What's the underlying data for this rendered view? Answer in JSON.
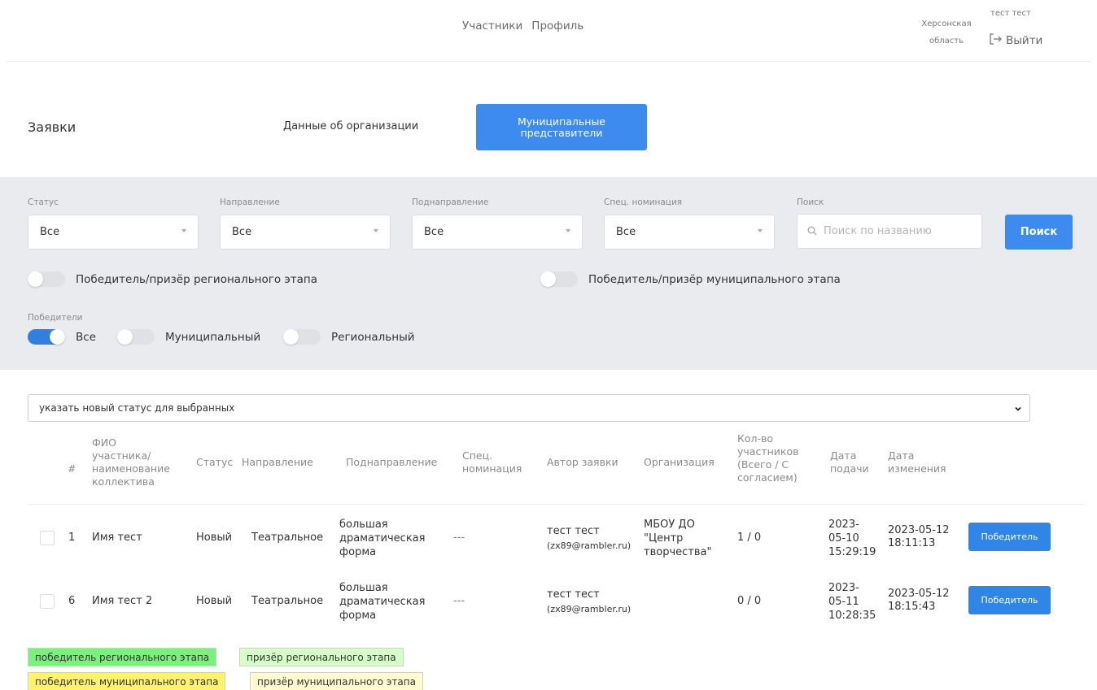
{
  "header": {
    "nav": [
      "Участники",
      "Профиль"
    ],
    "region": "Херсонская область",
    "user": "тест тест",
    "logout_label": "Выйти"
  },
  "tabs": {
    "title": "Заявки",
    "org": "Данные об организации",
    "muni": "Муниципальные представители"
  },
  "filters": {
    "status_label": "Статус",
    "status_value": "Все",
    "direction_label": "Направление",
    "direction_value": "Все",
    "subdirection_label": "Поднаправление",
    "subdirection_value": "Все",
    "nomination_label": "Спец. номинация",
    "nomination_value": "Все",
    "search_label": "Поиск",
    "search_placeholder": "Поиск по названию",
    "search_button": "Поиск",
    "regional_toggle_label": "Победитель/призёр регионального этапа",
    "municipal_toggle_label": "Победитель/призёр муниципального этапа",
    "winners_label": "Победители",
    "winners_options": [
      "Все",
      "Муниципальный",
      "Региональный"
    ],
    "winners_selected": "Все"
  },
  "bulk_status": {
    "placeholder": "указать новый статус для выбранных"
  },
  "table": {
    "headers": {
      "num": "#",
      "fio": "ФИО участника/ наименование коллектива",
      "status": "Статус",
      "direction": "Направление",
      "subdirection": "Поднаправление",
      "nomination": "Спец. номинация",
      "author": "Автор заявки",
      "organization": "Организация",
      "count": "Кол-во участников (Всего / С согласием)",
      "submitted": "Дата подачи",
      "changed": "Дата изменения"
    },
    "rows": [
      {
        "num": "1",
        "fio": "Имя тест",
        "status": "Новый",
        "direction": "Театральное",
        "subdirection": "большая драматическая форма",
        "nomination": "---",
        "author_name": "тест тест",
        "author_email": "(zx89@rambler.ru)",
        "organization": "МБОУ ДО \"Центр творчества\"",
        "count": "1 / 0",
        "submitted": "2023-05-10 15:29:19",
        "changed": "2023-05-12 18:11:13",
        "button": "Победитель"
      },
      {
        "num": "6",
        "fio": "Имя тест 2",
        "status": "Новый",
        "direction": "Театральное",
        "subdirection": "большая драматическая форма",
        "nomination": "---",
        "author_name": "тест тест",
        "author_email": "(zx89@rambler.ru)",
        "organization": "",
        "count": "0 / 0",
        "submitted": "2023-05-11 10:28:35",
        "changed": "2023-05-12 18:15:43",
        "button": "Победитель"
      }
    ]
  },
  "legend": {
    "regional_winner": "победитель регионального этапа",
    "regional_prize": "призёр регионального этапа",
    "municipal_winner": "победитель муниципального этапа",
    "municipal_prize": "призёр муниципального этапа"
  },
  "colors": {
    "primary": "#3d8bef",
    "regional_winner_bg": "#7cf07c",
    "regional_prize_bg": "#d6ffc8",
    "municipal_winner_bg": "#fff36a",
    "municipal_prize_bg": "#fffbcf"
  },
  "icons": [
    "caret-down-icon",
    "search-icon",
    "logout-icon",
    "chevron-down-icon"
  ]
}
